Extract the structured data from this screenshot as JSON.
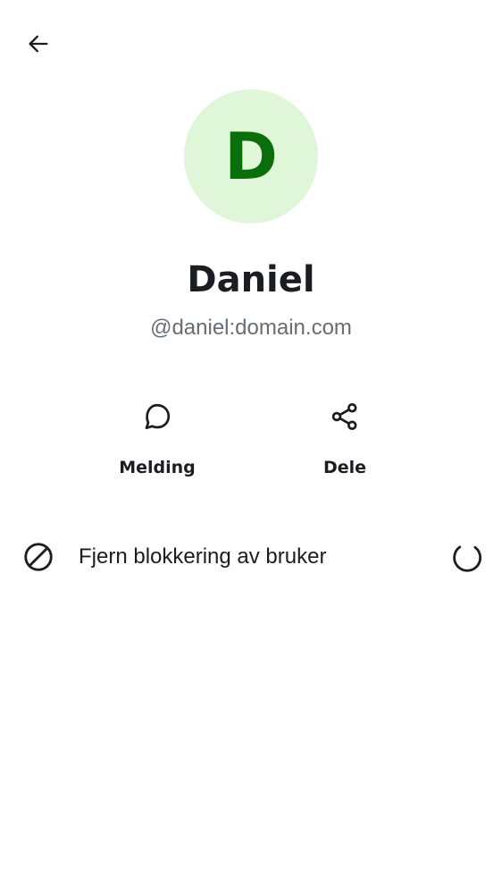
{
  "header": {
    "back_icon": "arrow-left-icon"
  },
  "profile": {
    "avatar_letter": "D",
    "avatar_bg": "#e0f6d9",
    "avatar_fg": "#0a6e0a",
    "display_name": "Daniel",
    "user_id": "@daniel:domain.com"
  },
  "actions": [
    {
      "icon": "chat-bubble-icon",
      "label": "Melding"
    },
    {
      "icon": "share-icon",
      "label": "Dele"
    }
  ],
  "settings": {
    "unblock": {
      "icon": "block-icon",
      "label": "Fjern blokkering av bruker",
      "status_icon": "loading-spinner-icon"
    }
  }
}
